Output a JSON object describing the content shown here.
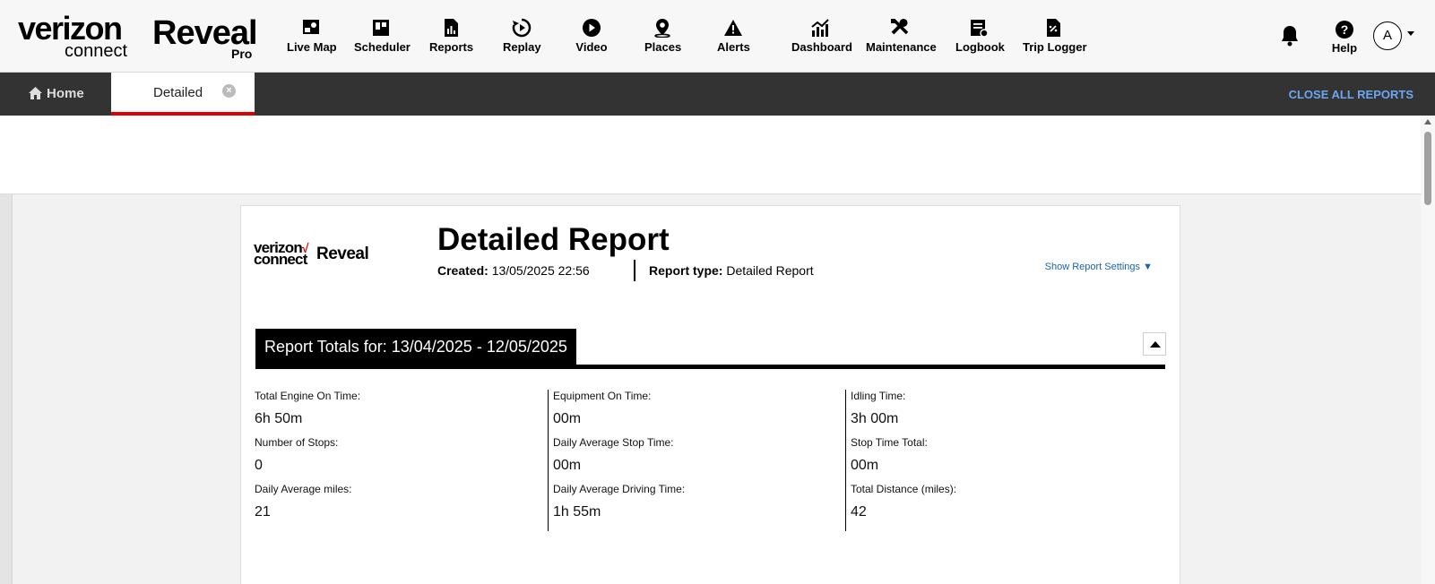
{
  "brand": {
    "verizon": "verizon",
    "connect": "connect",
    "reveal": "Reveal",
    "pro": "Pro"
  },
  "nav": [
    {
      "label": "Live Map",
      "icon": "live-map-icon"
    },
    {
      "label": "Scheduler",
      "icon": "scheduler-icon"
    },
    {
      "label": "Reports",
      "icon": "reports-icon"
    },
    {
      "label": "Replay",
      "icon": "replay-icon"
    },
    {
      "label": "Video",
      "icon": "video-icon"
    },
    {
      "label": "Places",
      "icon": "places-icon"
    },
    {
      "label": "Alerts",
      "icon": "alerts-icon"
    },
    {
      "label": "Dashboard",
      "icon": "dashboard-icon"
    },
    {
      "label": "Maintenance",
      "icon": "maintenance-icon"
    },
    {
      "label": "Logbook",
      "icon": "logbook-icon"
    },
    {
      "label": "Trip Logger",
      "icon": "trip-logger-icon"
    }
  ],
  "header_right": {
    "help_label": "Help",
    "avatar_initial": "A"
  },
  "tabs": {
    "home": "Home",
    "active": "Detailed",
    "close_all": "CLOSE ALL REPORTS"
  },
  "report": {
    "logo": {
      "line1": "verizon",
      "check": "√",
      "line2": "connect",
      "product": "Reveal"
    },
    "title": "Detailed Report",
    "created_label": "Created:",
    "created_value": "13/05/2025 22:56",
    "type_label": "Report type:",
    "type_value": "Detailed Report",
    "show_settings": "Show Report Settings ▼",
    "totals_heading": "Report Totals for: 13/04/2025 - 12/05/2025",
    "columns": [
      [
        {
          "label": "Total Engine On Time:",
          "value": "6h 50m"
        },
        {
          "label": "Number of Stops:",
          "value": "0"
        },
        {
          "label": "Daily Average miles:",
          "value": "21"
        }
      ],
      [
        {
          "label": "Equipment On Time:",
          "value": "00m"
        },
        {
          "label": "Daily Average Stop Time:",
          "value": "00m"
        },
        {
          "label": "Daily Average Driving Time:",
          "value": "1h 55m"
        }
      ],
      [
        {
          "label": "Idling Time:",
          "value": "3h 00m"
        },
        {
          "label": "Stop Time Total:",
          "value": "00m"
        },
        {
          "label": "Total Distance (miles):",
          "value": "42"
        }
      ]
    ]
  },
  "colors": {
    "nav_bg": "#f7f7f7",
    "tabbar_bg": "#333333",
    "active_tab_underline": "#e00000",
    "close_all_link": "#6aa7f0",
    "settings_link": "#1a63b5"
  }
}
